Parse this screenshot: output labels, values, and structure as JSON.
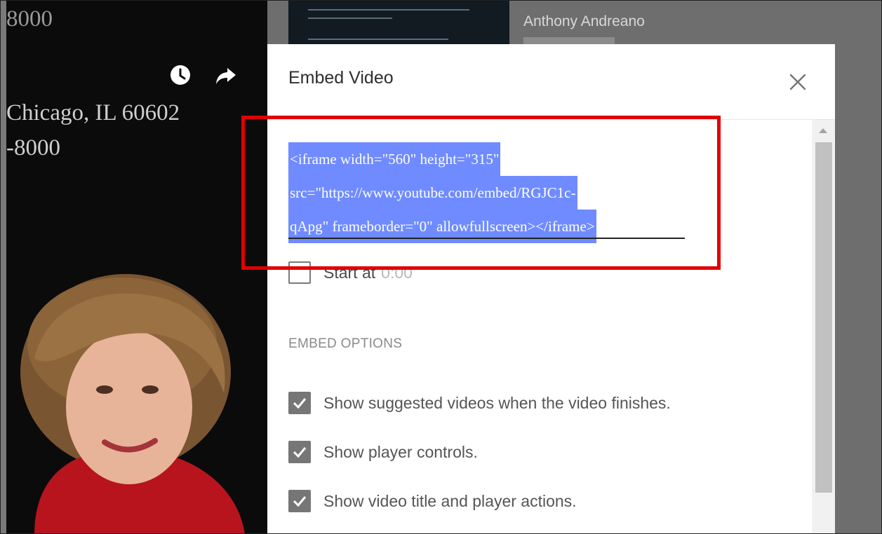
{
  "background": {
    "phone_top": "8000",
    "city": "Chicago, IL 60602",
    "phone": "-8000",
    "watch_later_icon": "clock-icon",
    "share_icon": "share-arrow-icon",
    "channel_name": "Anthony Andreano"
  },
  "modal": {
    "title": "Embed Video",
    "close_icon": "close-icon",
    "embed_code": {
      "line1": "<iframe width=\"560\" height=\"315\"",
      "line2": "src=\"https://www.youtube.com/embed/RGJC1c-",
      "line3": "qApg\" frameborder=\"0\" allowfullscreen></iframe>"
    },
    "start_at": {
      "label": "Start at",
      "value": "0:00",
      "checked": false
    },
    "options_heading": "EMBED OPTIONS",
    "options": [
      {
        "label": "Show suggested videos when the video finishes.",
        "checked": true
      },
      {
        "label": "Show player controls.",
        "checked": true
      },
      {
        "label": "Show video title and player actions.",
        "checked": true
      }
    ]
  },
  "colors": {
    "selection": "#6f8bff",
    "highlight_border": "#e00000",
    "checkbox_fill": "#767676"
  }
}
